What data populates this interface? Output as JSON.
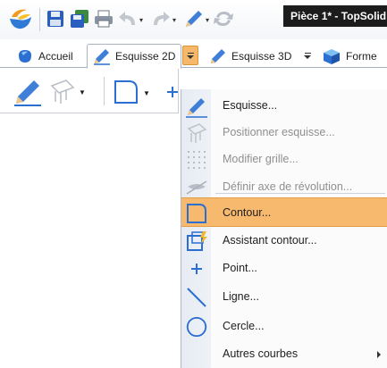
{
  "window": {
    "title": "Pièce 1* - TopSolid"
  },
  "tabs": [
    {
      "label": "Accueil",
      "icon": "part-icon"
    },
    {
      "label": "Esquisse 2D",
      "icon": "sketch-pencil-icon",
      "active": true
    },
    {
      "label": "Esquisse 3D",
      "icon": "sketch-pencil-icon"
    },
    {
      "label": "Forme",
      "icon": "cube-icon"
    }
  ],
  "menu": {
    "items": [
      {
        "label": "Esquisse...",
        "icon": "sketch-pencil-icon",
        "enabled": true
      },
      {
        "label": "Positionner esquisse...",
        "icon": "position-sketch-icon",
        "enabled": false
      },
      {
        "label": "Modifier grille...",
        "icon": "grid-icon",
        "enabled": false
      },
      {
        "label": "Définir axe de révolution...",
        "icon": "revolution-axis-icon",
        "enabled": false
      },
      {
        "label": "Contour...",
        "icon": "contour-icon",
        "enabled": true,
        "highlighted": true
      },
      {
        "label": "Assistant contour...",
        "icon": "contour-assistant-icon",
        "enabled": true
      },
      {
        "label": "Point...",
        "icon": "point-icon",
        "enabled": true
      },
      {
        "label": "Ligne...",
        "icon": "line-icon",
        "enabled": true
      },
      {
        "label": "Cercle...",
        "icon": "circle-icon",
        "enabled": true
      },
      {
        "label": "Autres courbes",
        "icon": "",
        "enabled": true,
        "submenu": true
      }
    ]
  },
  "colors": {
    "accent": "#f7b96e",
    "titlebar": "#1c1c1c",
    "icon_blue": "#2a6fd1",
    "gutter": "#e6ebf3"
  }
}
